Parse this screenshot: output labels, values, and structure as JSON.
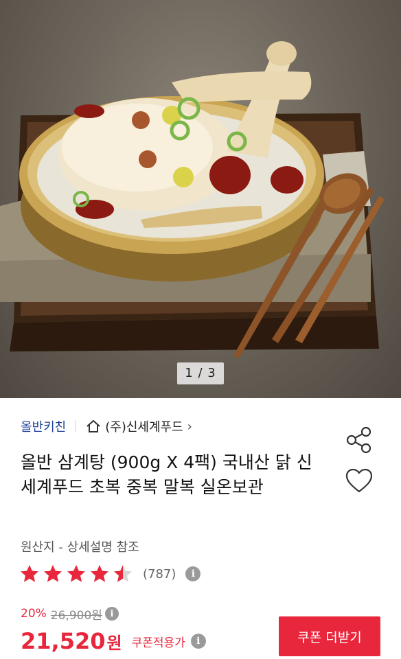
{
  "hero": {
    "alt": "삼계탕 상품 이미지",
    "pager": "1 / 3"
  },
  "product": {
    "brand": "올반키친",
    "seller": "(주)신세계푸드",
    "title": "올반 삼계탕 (900g X 4팩) 국내산 닭 신세계푸드 초복 중복 말복 실온보관",
    "origin": "원산지 - 상세설명 참조",
    "rating": 4.5,
    "review_count": "(787)",
    "discount": "20%",
    "original_price": "26,900원",
    "sale_price": "21,520",
    "won": "원",
    "coupon_label": "쿠폰적용가",
    "coupon_button": "쿠폰 더받기"
  },
  "icons": [
    "home-icon",
    "chevron-right-icon",
    "share-icon",
    "heart-icon",
    "star-icon",
    "info-icon"
  ],
  "colors": {
    "accent": "#e8263c",
    "brand": "#1f3f9a",
    "star": "#e8263c"
  }
}
